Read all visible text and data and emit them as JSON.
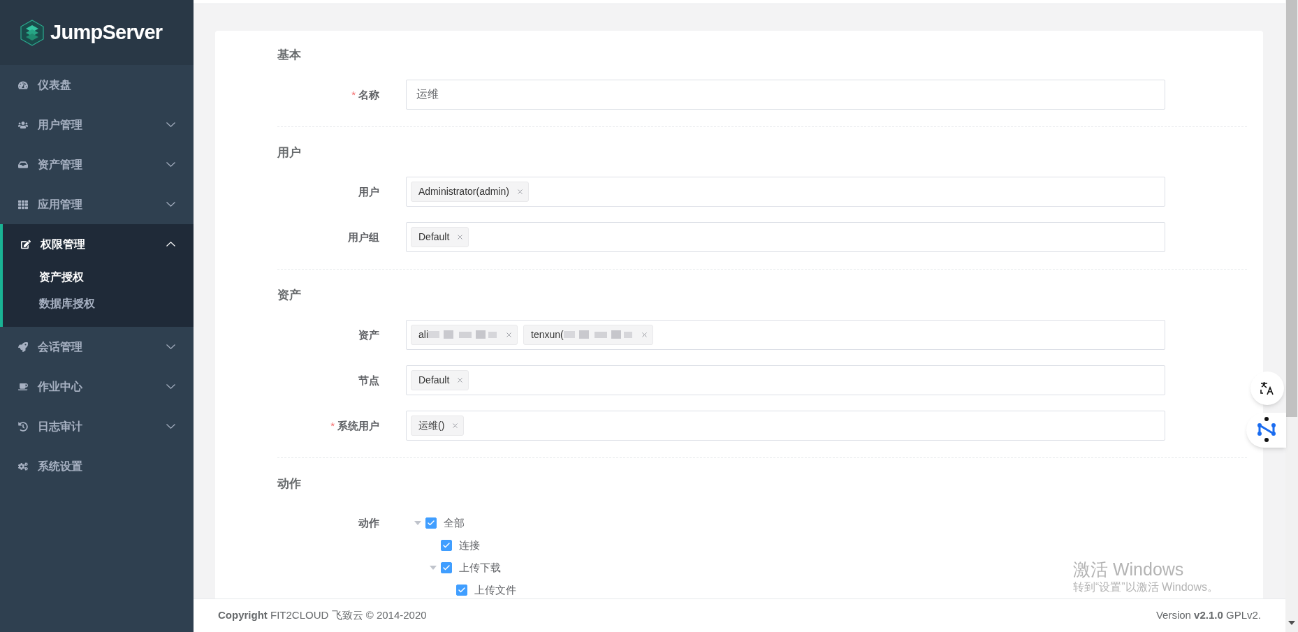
{
  "sidebar": {
    "logo": "JumpServer",
    "items": [
      {
        "label": "仪表盘",
        "selected": false
      },
      {
        "label": "用户管理",
        "selected": false,
        "expanded": false
      },
      {
        "label": "资产管理",
        "selected": false,
        "expanded": false
      },
      {
        "label": "应用管理",
        "selected": false,
        "expanded": false
      },
      {
        "label": "权限管理",
        "selected": true,
        "expanded": true,
        "children": [
          {
            "label": "资产授权",
            "selected": true
          },
          {
            "label": "数据库授权",
            "selected": false
          }
        ]
      },
      {
        "label": "会话管理",
        "selected": false,
        "expanded": false
      },
      {
        "label": "作业中心",
        "selected": false,
        "expanded": false
      },
      {
        "label": "日志审计",
        "selected": false,
        "expanded": false
      },
      {
        "label": "系统设置",
        "selected": false
      }
    ]
  },
  "form": {
    "required_marker": "*",
    "sections": [
      {
        "title": "基本",
        "fields": [
          {
            "kind": "text",
            "label": "名称",
            "required": true,
            "value": "运维"
          }
        ]
      },
      {
        "title": "用户",
        "fields": [
          {
            "kind": "tags",
            "label": "用户",
            "required": false,
            "tags": [
              {
                "text": "Administrator(admin)",
                "redacted": false
              }
            ]
          },
          {
            "kind": "tags",
            "label": "用户组",
            "required": false,
            "tags": [
              {
                "text": "Default",
                "redacted": false
              }
            ]
          }
        ]
      },
      {
        "title": "资产",
        "fields": [
          {
            "kind": "tags",
            "label": "资产",
            "required": false,
            "tags": [
              {
                "text": "ali",
                "redacted": true
              },
              {
                "text": "tenxun(",
                "redacted": true
              }
            ]
          },
          {
            "kind": "tags",
            "label": "节点",
            "required": false,
            "tags": [
              {
                "text": "Default",
                "redacted": false
              }
            ]
          },
          {
            "kind": "tags",
            "label": "系统用户",
            "required": true,
            "tags": [
              {
                "text": "运维()",
                "redacted": false
              }
            ]
          }
        ]
      },
      {
        "title": "动作",
        "fields": [
          {
            "kind": "tree",
            "label": "动作",
            "required": false,
            "nodes": [
              {
                "label": "全部",
                "checked": true,
                "expanded": true,
                "children": [
                  {
                    "label": "连接",
                    "checked": true
                  },
                  {
                    "label": "上传下载",
                    "checked": true,
                    "expanded": true,
                    "children": [
                      {
                        "label": "上传文件",
                        "checked": true
                      }
                    ]
                  }
                ]
              }
            ]
          }
        ]
      }
    ]
  },
  "footer": {
    "copyright": "**Copyright** FIT2CLOUD 飞致云 © 2014-2020",
    "version": "Version **v2.1.0** GPLv2."
  },
  "os_notice": {
    "title": "激活 Windows",
    "subtitle": "转到“设置”以激活 Windows。"
  }
}
